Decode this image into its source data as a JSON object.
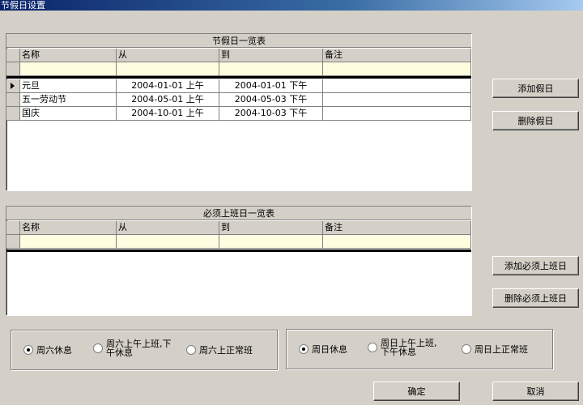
{
  "window": {
    "title": "节假日设置"
  },
  "holiday_table": {
    "caption": "节假日一览表",
    "columns": [
      "名称",
      "从",
      "到",
      "备注"
    ],
    "rows": [
      {
        "name": "元旦",
        "from": "2004-01-01 上午",
        "to": "2004-01-01 下午",
        "note": ""
      },
      {
        "name": "五一劳动节",
        "from": "2004-05-01 上午",
        "to": "2004-05-03 下午",
        "note": ""
      },
      {
        "name": "国庆",
        "from": "2004-10-01 上午",
        "to": "2004-10-03 下午",
        "note": ""
      }
    ]
  },
  "workday_table": {
    "caption": "必须上班日一览表",
    "columns": [
      "名称",
      "从",
      "到",
      "备注"
    ]
  },
  "buttons": {
    "add_holiday": "添加假日",
    "delete_holiday": "删除假日",
    "add_workday": "添加必须上班日",
    "delete_workday": "删除必须上班日",
    "ok": "确定",
    "cancel": "取消"
  },
  "saturday_options": {
    "rest": {
      "label": "周六休息",
      "checked": true
    },
    "half": {
      "label_line1": "周六上午上班,下",
      "label_line2": "午休息",
      "checked": false
    },
    "work": {
      "label": "周六上正常班",
      "checked": false
    }
  },
  "sunday_options": {
    "rest": {
      "label": "周日休息",
      "checked": true
    },
    "half": {
      "label_line1": "周日上午上班,",
      "label_line2": "下午休息",
      "checked": false
    },
    "work": {
      "label": "周日上正常班",
      "checked": false
    }
  }
}
